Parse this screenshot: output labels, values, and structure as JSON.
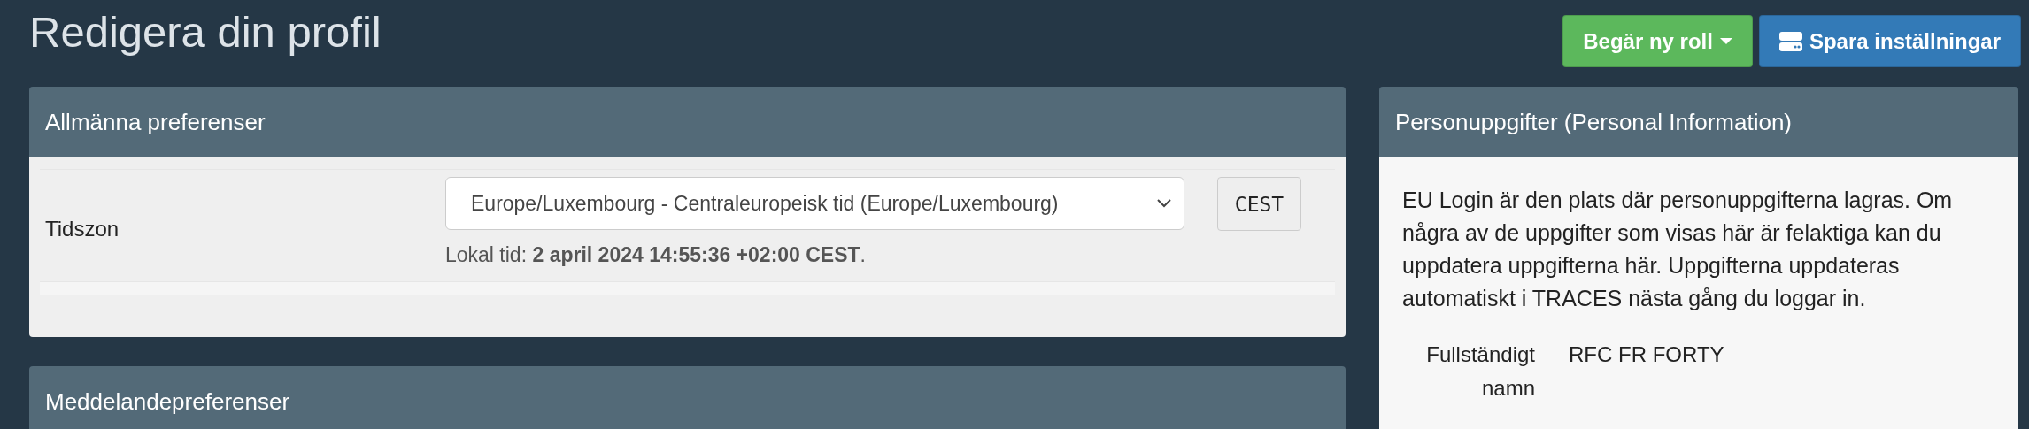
{
  "page_title": "Redigera din profil",
  "actions": [
    {
      "kind": "dropdown",
      "label": "Begär ny roll",
      "color": "#5cb85c"
    },
    {
      "kind": "save",
      "label": "Spara inställningar",
      "color": "#337ab7"
    }
  ],
  "general": {
    "title": "Allmänna preferenser",
    "timezone_label": "Tidszon",
    "timezone_value": "Europe/Luxembourg - Centraleuropeisk tid (Europe/Luxembourg)",
    "zone_code": "CEST",
    "local_time": "Lokal tid: **2 april 2024 14:55:36 +02:00 CEST**."
  },
  "notifications": {
    "title": "Meddelandepreferenser"
  },
  "personal": {
    "title": "Personuppgifter (Personal Information)",
    "intro": "EU Login är den plats där personuppgifterna lagras. Om några av de uppgifter som visas här är felaktiga kan du uppdatera uppgifterna här. Uppgifterna uppdateras automatiskt i TRACES nästa gång du loggar in.",
    "fields": [
      {
        "label": "Fullständigt namn",
        "value": "RFC FR FORTY"
      }
    ]
  }
}
